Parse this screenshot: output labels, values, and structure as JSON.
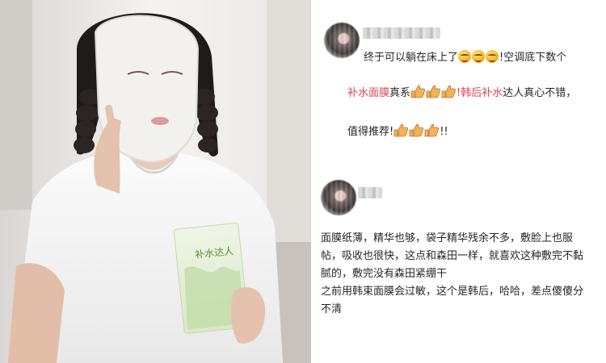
{
  "photo": {
    "packet_text": "补水达人"
  },
  "comment1": {
    "line1_pre": "终于可以躺在床上了",
    "line1_post": "!空调底下数个",
    "line2_red1": "补水面膜",
    "line2_mid": "真系",
    "line2_red2": "!韩后补水",
    "line2_post": "达人真心不错，",
    "line3_pre": "值得推荐!",
    "line3_post": "!!"
  },
  "comment2": {
    "line1": "面膜纸薄，精华也够，袋子精华残余不多，敷脸上也服",
    "line2": "帖，吸收也很快，这点和森田一样，就喜欢这种敷完不黏",
    "line3": "腻的，敷完没有森田紧绷干",
    "line4": "之前用韩束面膜会过敏，这个是韩后，哈哈，差点傻傻分",
    "line5": "不清"
  },
  "colors": {
    "highlight": "#e0444e",
    "text": "#262626",
    "background": "#ffffff"
  },
  "icons": [
    "blurred-avatar",
    "smiling-face-emoji",
    "thumbs-up-emoji"
  ]
}
